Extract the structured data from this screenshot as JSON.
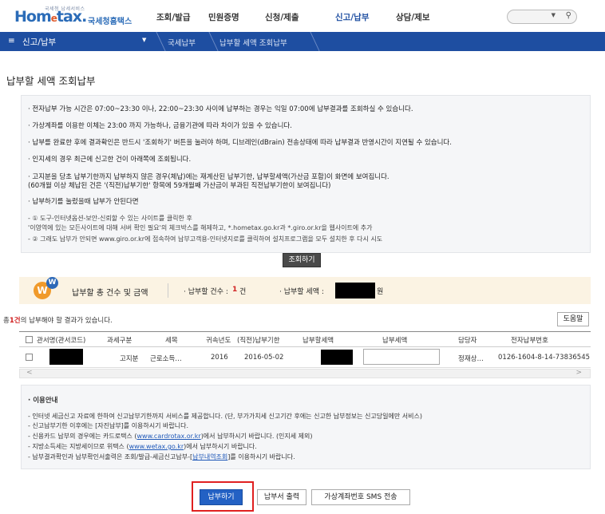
{
  "header": {
    "logo_small": "국세청 납세서비스",
    "logo_main": "Hometax",
    "logo_sub": "국세청홈택스",
    "gnb": [
      "조회/발급",
      "민원증명",
      "신청/제출",
      "신고/납부",
      "상담/제보"
    ],
    "search_icon": "search-icon"
  },
  "navbar": {
    "menu": "신고/납부",
    "breadcrumbs": [
      "국세납부",
      "납부할 세액 조회납부"
    ]
  },
  "page_title": "납부할 세액 조회납부",
  "notice": {
    "lines": [
      "· 전자납부 가능 시간은 07:00~23:30 이나, 22:00~23:30 사이에 납부하는 경우는 익일 07:00에 납부결과를 조회하실 수 있습니다.",
      "· 가상계좌를 이용한 이체는 23:00 까지 가능하나, 금융기관에 따라 차이가 있을 수 있습니다.",
      "· 납부를 완료한 후에 결과확인은 반드시 '조회하기' 버튼을 눌러야 하며, 디브레인(dBrain) 전송상태에 따라 납부결과 반영시간이 지연될 수 있습니다.",
      "· 인지세의 경우 최근에 신고한 건이 아래쪽에 조회됩니다.",
      "· 고지분을 당초 납부기한까지 납부하지 않은 경우(체납)에는 재계산된 납부기한, 납부할세액(가산금 포함)이 화면에 보여집니다.",
      "  (60개월 이상 체납된 건은 '(직전)납부기한' 항목에 59개월째 가산금이 부과된 직전납부기한이 보여집니다)",
      "· 납부하기를 눌렀을때 납부가 안된다면"
    ],
    "sub_lines": [
      "- ① 도구-인터넷옵션-보안-신뢰할 수 있는 사이트를 클릭한 후",
      "  '이영역에 있는 모든사이트에 대해 서버 확인 필요'의 체크박스를 해제하고, *.hometax.go.kr과 *.giro.or.kr을 웹사이트에 추가",
      "- ② 그래도 납부가 안되면 www.giro.or.kr에 접속하여 납부고객용-인터넷지로를 클릭하여 설치프로그램을 모두 설치한 후 다시 시도"
    ]
  },
  "inquiry_button": "조회하기",
  "summary": {
    "badge": "W",
    "badge2": "W",
    "label": "납부할 총 건수 및 금액",
    "count_label": "· 납부할 건수 :",
    "count_value": "1",
    "count_unit": "건",
    "amount_label": "· 납부할 세액 :",
    "amount_unit": "원"
  },
  "result_text": {
    "prefix": "총",
    "count": "1건",
    "suffix": "의 납부해야 할 결과가 있습니다."
  },
  "help_button": "도움말",
  "table": {
    "headers": [
      "관서명(관서코드)",
      "과세구분",
      "세목",
      "귀속년도",
      "(직전)납부기한",
      "납부할세액",
      "납부세액",
      "담당자",
      "전자납부번호"
    ],
    "rows": [
      {
        "tax_class": "고지분",
        "tax_item": "근로소득…",
        "year": "2016",
        "due_date": "2016-05-02",
        "manager": "정재상…",
        "payment_no": "0126-1604-8-14-73836545"
      }
    ]
  },
  "scroll": {
    "left": "<",
    "right": ">"
  },
  "info": {
    "title": "· 이용안내",
    "lines": [
      "- 인터넷 세금신고 자료에 한하여 신고납부기한까지 서비스를 제공합니다. (단, 부가가치세 신고기간 후에는 신고한 납부정보는 신고당일에만 서비스)",
      "- 신고납부기한 이후에는 [자진납부]를 이용하시기 바랍니다.",
      "- 지방소득세는 지방세이므로 위택스 ("
    ],
    "card_pre": "- 신용카드 납부의 경우에는 카드로택스 (",
    "card_link": "www.cardrotax.or.kr",
    "card_post": ")에서 납부하시기 바랍니다. (인지세 제외)",
    "wetax_pre": "- 지방소득세는 지방세이므로 위택스 (",
    "wetax_link": "www.wetax.go.kr",
    "wetax_post": ")에서 납부하시기 바랍니다.",
    "result_pre": "- 납부결과확인과 납부확인서출력은 조회/발급-세금신고납부-[",
    "result_link": "납부내역조회",
    "result_post": "]를 이용하시기 바랍니다."
  },
  "buttons": {
    "pay": "납부하기",
    "print": "납부서 출력",
    "sms": "가상계좌번호 SMS 전송"
  }
}
